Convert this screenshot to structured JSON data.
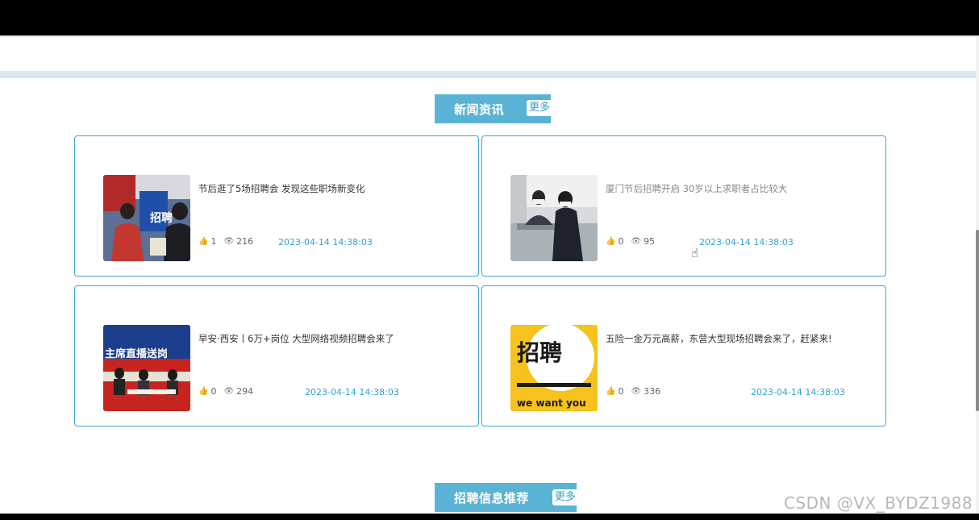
{
  "news_section": {
    "title": "新闻资讯",
    "more_label": "更多",
    "items": [
      {
        "title": "节后逛了5场招聘会 发现这些职场新变化",
        "likes": "1",
        "views": "216",
        "date": "2023-04-14 14:38:03",
        "image": "job-fair-photo"
      },
      {
        "title": "厦门节后招聘开启 30岁以上求职者占比较大",
        "likes": "0",
        "views": "95",
        "date": "2023-04-14 14:38:03",
        "image": "interview-desk-photo"
      },
      {
        "title": "早安·西安丨6万+岗位 大型网络视频招聘会来了",
        "likes": "0",
        "views": "294",
        "date": "2023-04-14 14:38:03",
        "image": "stage-broadcast-photo",
        "image_text": "主席直播送岗"
      },
      {
        "title": "五险一金万元高薪，东营大型现场招聘会来了，赶紧来!",
        "likes": "0",
        "views": "336",
        "date": "2023-04-14 14:38:03",
        "image": "recruit-poster",
        "image_text": "招聘",
        "image_text_2": "we want you"
      }
    ]
  },
  "recommend_section": {
    "title": "招聘信息推荐",
    "more_label": "更多"
  },
  "watermark": "CSDN @VX_BYDZ1988",
  "colors": {
    "accent": "#5ab3d4",
    "border": "#3aa6d0",
    "date": "#2fa4cf"
  }
}
